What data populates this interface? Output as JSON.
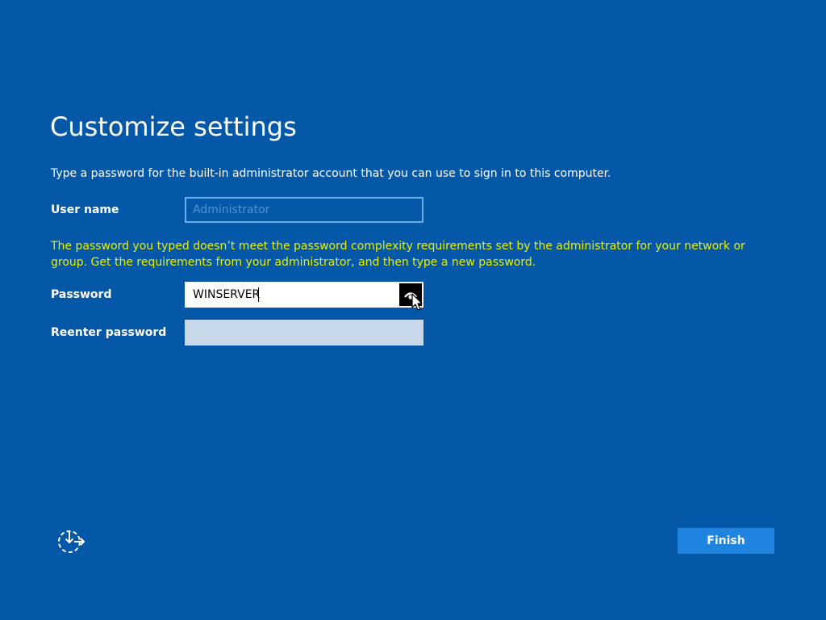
{
  "page": {
    "title": "Customize settings",
    "instructions": "Type a password for the built-in administrator account that you can use to sign in to this computer."
  },
  "username": {
    "label": "User name",
    "placeholder": "Administrator",
    "value": ""
  },
  "error": {
    "message": "The password you typed doesn’t meet the password complexity requirements set by the administrator for your network or group. Get the requirements from your administrator, and then type a new password."
  },
  "password": {
    "label": "Password",
    "value": "WINSERVER",
    "reveal_icon": "eye-icon"
  },
  "reenter_password": {
    "label": "Reenter password",
    "value": ""
  },
  "footer": {
    "accessibility_icon": "ease-of-access-icon",
    "finish_label": "Finish"
  },
  "colors": {
    "background": "#0558a8",
    "error_text": "#e8f000",
    "button": "#1e84e0",
    "field_border": "#6aaee8"
  }
}
